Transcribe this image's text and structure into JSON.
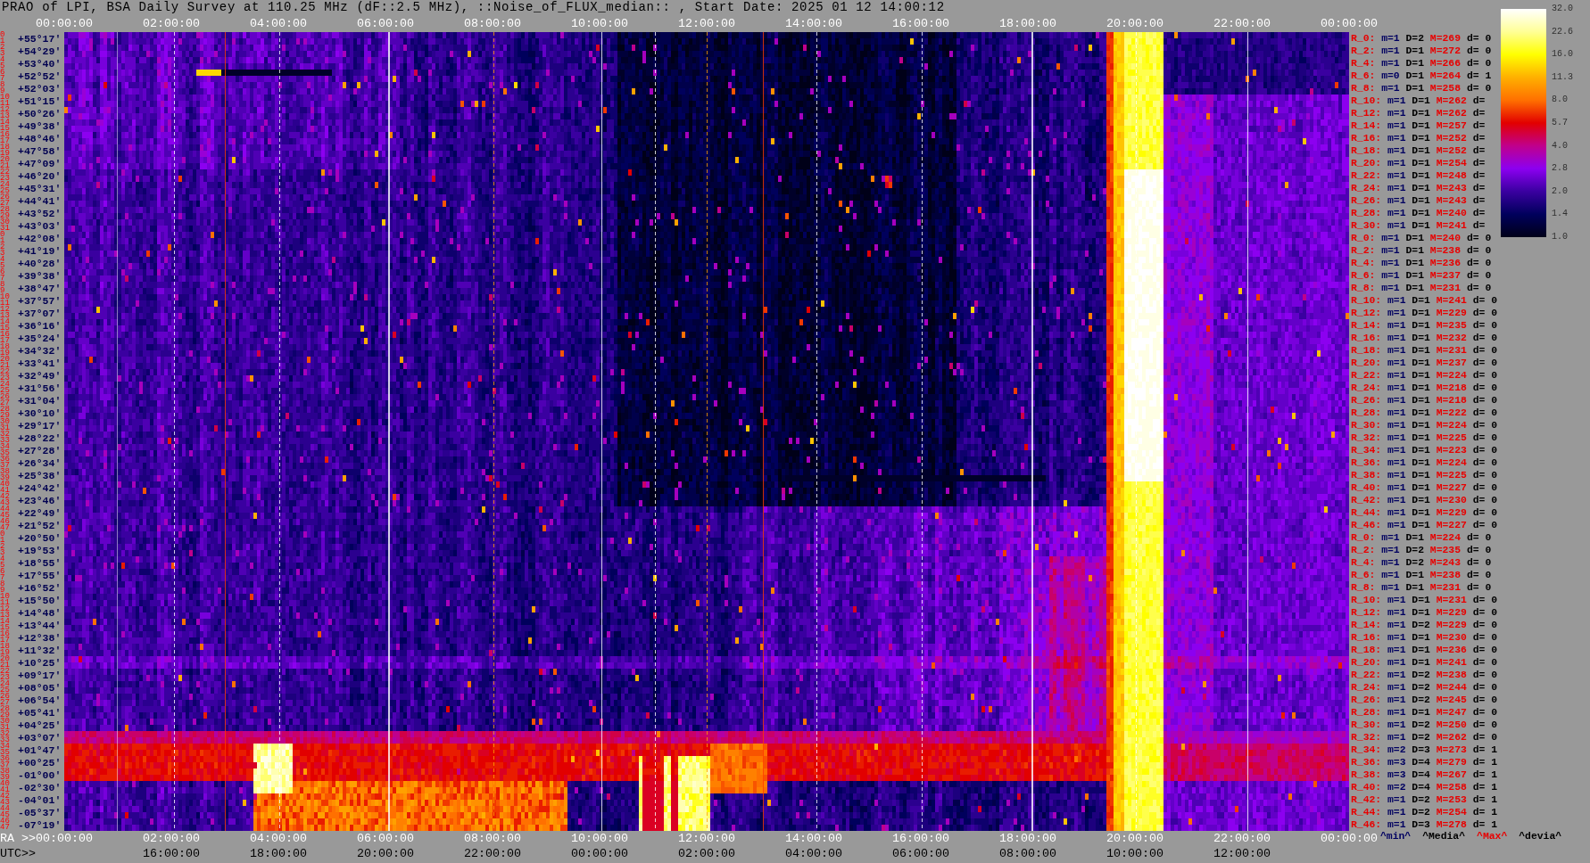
{
  "title": "PRAO of LPI, BSA Daily Survey at 110.25 MHz (dF::2.5 MHz), ::Noise_of_FLUX_median:: , Start Date: 2025 01 12 14:00:12",
  "top_axis": {
    "ticks": [
      "00:00:00",
      "02:00:00",
      "04:00:00",
      "06:00:00",
      "08:00:00",
      "10:00:00",
      "12:00:00",
      "14:00:00",
      "16:00:00",
      "18:00:00",
      "20:00:00",
      "22:00:00",
      "00:00:00"
    ]
  },
  "rows": [
    {
      "beams": [
        "0",
        "1"
      ],
      "declination": "+55°17'",
      "stats": {
        "label": "R_0:",
        "min": "m=1",
        "median": "D=2",
        "max": "M=269",
        "deviation": "d= 0"
      }
    },
    {
      "beams": [
        "2",
        "3"
      ],
      "declination": "+54°29'",
      "stats": {
        "label": "R_2:",
        "min": "m=1",
        "median": "D=1",
        "max": "M=272",
        "deviation": "d= 0"
      }
    },
    {
      "beams": [
        "4",
        "5"
      ],
      "declination": "+53°40'",
      "stats": {
        "label": "R_4:",
        "min": "m=1",
        "median": "D=1",
        "max": "M=266",
        "deviation": "d= 0"
      }
    },
    {
      "beams": [
        "6",
        "7"
      ],
      "declination": "+52°52'",
      "stats": {
        "label": "R_6:",
        "min": "m=0",
        "median": "D=1",
        "max": "M=264",
        "deviation": "d= 1"
      }
    },
    {
      "beams": [
        "8",
        "9"
      ],
      "declination": "+52°03'",
      "stats": {
        "label": "R_8:",
        "min": "m=1",
        "median": "D=1",
        "max": "M=258",
        "deviation": "d= 0"
      }
    },
    {
      "beams": [
        "10",
        "11"
      ],
      "declination": "+51°15'",
      "stats": {
        "label": "R_10:",
        "min": "m=1",
        "median": "D=1",
        "max": "M=262",
        "deviation": "d="
      }
    },
    {
      "beams": [
        "12",
        "13"
      ],
      "declination": "+50°26'",
      "stats": {
        "label": "R_12:",
        "min": "m=1",
        "median": "D=1",
        "max": "M=262",
        "deviation": "d="
      }
    },
    {
      "beams": [
        "14",
        "15"
      ],
      "declination": "+49°38'",
      "stats": {
        "label": "R_14:",
        "min": "m=1",
        "median": "D=1",
        "max": "M=257",
        "deviation": "d="
      }
    },
    {
      "beams": [
        "16",
        "17"
      ],
      "declination": "+48°46'",
      "stats": {
        "label": "R_16:",
        "min": "m=1",
        "median": "D=1",
        "max": "M=252",
        "deviation": "d="
      }
    },
    {
      "beams": [
        "18",
        "19"
      ],
      "declination": "+47°58'",
      "stats": {
        "label": "R_18:",
        "min": "m=1",
        "median": "D=1",
        "max": "M=252",
        "deviation": "d="
      }
    },
    {
      "beams": [
        "20",
        "21"
      ],
      "declination": "+47°09'",
      "stats": {
        "label": "R_20:",
        "min": "m=1",
        "median": "D=1",
        "max": "M=254",
        "deviation": "d="
      }
    },
    {
      "beams": [
        "22",
        "23"
      ],
      "declination": "+46°20'",
      "stats": {
        "label": "R_22:",
        "min": "m=1",
        "median": "D=1",
        "max": "M=248",
        "deviation": "d="
      }
    },
    {
      "beams": [
        "24",
        "25"
      ],
      "declination": "+45°31'",
      "stats": {
        "label": "R_24:",
        "min": "m=1",
        "median": "D=1",
        "max": "M=243",
        "deviation": "d="
      }
    },
    {
      "beams": [
        "26",
        "27"
      ],
      "declination": "+44°41'",
      "stats": {
        "label": "R_26:",
        "min": "m=1",
        "median": "D=1",
        "max": "M=243",
        "deviation": "d="
      }
    },
    {
      "beams": [
        "28",
        "29"
      ],
      "declination": "+43°52'",
      "stats": {
        "label": "R_28:",
        "min": "m=1",
        "median": "D=1",
        "max": "M=240",
        "deviation": "d="
      }
    },
    {
      "beams": [
        "30",
        "31"
      ],
      "declination": "+43°03'",
      "stats": {
        "label": "R_30:",
        "min": "m=1",
        "median": "D=1",
        "max": "M=241",
        "deviation": "d="
      }
    },
    {
      "beams": [
        "0",
        "1"
      ],
      "declination": "+42°08'",
      "stats": {
        "label": "R_0:",
        "min": "m=1",
        "median": "D=1",
        "max": "M=240",
        "deviation": "d= 0"
      }
    },
    {
      "beams": [
        "2",
        "3"
      ],
      "declination": "+41°19'",
      "stats": {
        "label": "R_2:",
        "min": "m=1",
        "median": "D=1",
        "max": "M=238",
        "deviation": "d= 0"
      }
    },
    {
      "beams": [
        "4",
        "5"
      ],
      "declination": "+40°28'",
      "stats": {
        "label": "R_4:",
        "min": "m=1",
        "median": "D=1",
        "max": "M=236",
        "deviation": "d= 0"
      }
    },
    {
      "beams": [
        "6",
        "7"
      ],
      "declination": "+39°38'",
      "stats": {
        "label": "R_6:",
        "min": "m=1",
        "median": "D=1",
        "max": "M=237",
        "deviation": "d= 0"
      }
    },
    {
      "beams": [
        "8",
        "9"
      ],
      "declination": "+38°47'",
      "stats": {
        "label": "R_8:",
        "min": "m=1",
        "median": "D=1",
        "max": "M=231",
        "deviation": "d= 0"
      }
    },
    {
      "beams": [
        "10",
        "11"
      ],
      "declination": "+37°57'",
      "stats": {
        "label": "R_10:",
        "min": "m=1",
        "median": "D=1",
        "max": "M=241",
        "deviation": "d= 0"
      }
    },
    {
      "beams": [
        "12",
        "13"
      ],
      "declination": "+37°07'",
      "stats": {
        "label": "R_12:",
        "min": "m=1",
        "median": "D=1",
        "max": "M=229",
        "deviation": "d= 0"
      }
    },
    {
      "beams": [
        "14",
        "15"
      ],
      "declination": "+36°16'",
      "stats": {
        "label": "R_14:",
        "min": "m=1",
        "median": "D=1",
        "max": "M=235",
        "deviation": "d= 0"
      }
    },
    {
      "beams": [
        "16",
        "17"
      ],
      "declination": "+35°24'",
      "stats": {
        "label": "R_16:",
        "min": "m=1",
        "median": "D=1",
        "max": "M=232",
        "deviation": "d= 0"
      }
    },
    {
      "beams": [
        "18",
        "19"
      ],
      "declination": "+34°32'",
      "stats": {
        "label": "R_18:",
        "min": "m=1",
        "median": "D=1",
        "max": "M=231",
        "deviation": "d= 0"
      }
    },
    {
      "beams": [
        "20",
        "21"
      ],
      "declination": "+33°41'",
      "stats": {
        "label": "R_20:",
        "min": "m=1",
        "median": "D=1",
        "max": "M=237",
        "deviation": "d= 0"
      }
    },
    {
      "beams": [
        "22",
        "23"
      ],
      "declination": "+32°49'",
      "stats": {
        "label": "R_22:",
        "min": "m=1",
        "median": "D=1",
        "max": "M=224",
        "deviation": "d= 0"
      }
    },
    {
      "beams": [
        "24",
        "25"
      ],
      "declination": "+31°56'",
      "stats": {
        "label": "R_24:",
        "min": "m=1",
        "median": "D=1",
        "max": "M=218",
        "deviation": "d= 0"
      }
    },
    {
      "beams": [
        "26",
        "27"
      ],
      "declination": "+31°04'",
      "stats": {
        "label": "R_26:",
        "min": "m=1",
        "median": "D=1",
        "max": "M=218",
        "deviation": "d= 0"
      }
    },
    {
      "beams": [
        "28",
        "29"
      ],
      "declination": "+30°10'",
      "stats": {
        "label": "R_28:",
        "min": "m=1",
        "median": "D=1",
        "max": "M=222",
        "deviation": "d= 0"
      }
    },
    {
      "beams": [
        "30",
        "31"
      ],
      "declination": "+29°17'",
      "stats": {
        "label": "R_30:",
        "min": "m=1",
        "median": "D=1",
        "max": "M=224",
        "deviation": "d= 0"
      }
    },
    {
      "beams": [
        "32",
        "33"
      ],
      "declination": "+28°22'",
      "stats": {
        "label": "R_32:",
        "min": "m=1",
        "median": "D=1",
        "max": "M=225",
        "deviation": "d= 0"
      }
    },
    {
      "beams": [
        "34",
        "35"
      ],
      "declination": "+27°28'",
      "stats": {
        "label": "R_34:",
        "min": "m=1",
        "median": "D=1",
        "max": "M=223",
        "deviation": "d= 0"
      }
    },
    {
      "beams": [
        "36",
        "37"
      ],
      "declination": "+26°34'",
      "stats": {
        "label": "R_36:",
        "min": "m=1",
        "median": "D=1",
        "max": "M=224",
        "deviation": "d= 0"
      }
    },
    {
      "beams": [
        "38",
        "39"
      ],
      "declination": "+25°38'",
      "stats": {
        "label": "R_38:",
        "min": "m=1",
        "median": "D=1",
        "max": "M=225",
        "deviation": "d= 0"
      }
    },
    {
      "beams": [
        "40",
        "41"
      ],
      "declination": "+24°42'",
      "stats": {
        "label": "R_40:",
        "min": "m=1",
        "median": "D=1",
        "max": "M=227",
        "deviation": "d= 0"
      }
    },
    {
      "beams": [
        "42",
        "43"
      ],
      "declination": "+23°46'",
      "stats": {
        "label": "R_42:",
        "min": "m=1",
        "median": "D=1",
        "max": "M=230",
        "deviation": "d= 0"
      }
    },
    {
      "beams": [
        "44",
        "45"
      ],
      "declination": "+22°49'",
      "stats": {
        "label": "R_44:",
        "min": "m=1",
        "median": "D=1",
        "max": "M=229",
        "deviation": "d= 0"
      }
    },
    {
      "beams": [
        "46",
        "47"
      ],
      "declination": "+21°52'",
      "stats": {
        "label": "R_46:",
        "min": "m=1",
        "median": "D=1",
        "max": "M=227",
        "deviation": "d= 0"
      }
    },
    {
      "beams": [
        "0",
        "1"
      ],
      "declination": "+20°50'",
      "stats": {
        "label": "R_0:",
        "min": "m=1",
        "median": "D=1",
        "max": "M=224",
        "deviation": "d= 0"
      }
    },
    {
      "beams": [
        "2",
        "3"
      ],
      "declination": "+19°53'",
      "stats": {
        "label": "R_2:",
        "min": "m=1",
        "median": "D=2",
        "max": "M=235",
        "deviation": "d= 0"
      }
    },
    {
      "beams": [
        "4",
        "5"
      ],
      "declination": "+18°55'",
      "stats": {
        "label": "R_4:",
        "min": "m=1",
        "median": "D=2",
        "max": "M=243",
        "deviation": "d= 0"
      }
    },
    {
      "beams": [
        "6",
        "7"
      ],
      "declination": "+17°55'",
      "stats": {
        "label": "R_6:",
        "min": "m=1",
        "median": "D=1",
        "max": "M=238",
        "deviation": "d= 0"
      }
    },
    {
      "beams": [
        "8",
        "9"
      ],
      "declination": "+16°52'",
      "stats": {
        "label": "R_8:",
        "min": "m=1",
        "median": "D=1",
        "max": "M=231",
        "deviation": "d= 0"
      }
    },
    {
      "beams": [
        "10",
        "11"
      ],
      "declination": "+15°50'",
      "stats": {
        "label": "R_10:",
        "min": "m=1",
        "median": "D=1",
        "max": "M=231",
        "deviation": "d= 0"
      }
    },
    {
      "beams": [
        "12",
        "13"
      ],
      "declination": "+14°48'",
      "stats": {
        "label": "R_12:",
        "min": "m=1",
        "median": "D=1",
        "max": "M=229",
        "deviation": "d= 0"
      }
    },
    {
      "beams": [
        "14",
        "15"
      ],
      "declination": "+13°44'",
      "stats": {
        "label": "R_14:",
        "min": "m=1",
        "median": "D=2",
        "max": "M=229",
        "deviation": "d= 0"
      }
    },
    {
      "beams": [
        "16",
        "17"
      ],
      "declination": "+12°38'",
      "stats": {
        "label": "R_16:",
        "min": "m=1",
        "median": "D=1",
        "max": "M=230",
        "deviation": "d= 0"
      }
    },
    {
      "beams": [
        "18",
        "19"
      ],
      "declination": "+11°32'",
      "stats": {
        "label": "R_18:",
        "min": "m=1",
        "median": "D=1",
        "max": "M=236",
        "deviation": "d= 0"
      }
    },
    {
      "beams": [
        "20",
        "21"
      ],
      "declination": "+10°25'",
      "stats": {
        "label": "R_20:",
        "min": "m=1",
        "median": "D=1",
        "max": "M=241",
        "deviation": "d= 0"
      }
    },
    {
      "beams": [
        "22",
        "23"
      ],
      "declination": "+09°17'",
      "stats": {
        "label": "R_22:",
        "min": "m=1",
        "median": "D=2",
        "max": "M=238",
        "deviation": "d= 0"
      }
    },
    {
      "beams": [
        "24",
        "25"
      ],
      "declination": "+08°05'",
      "stats": {
        "label": "R_24:",
        "min": "m=1",
        "median": "D=2",
        "max": "M=244",
        "deviation": "d= 0"
      }
    },
    {
      "beams": [
        "26",
        "27"
      ],
      "declination": "+06°54'",
      "stats": {
        "label": "R_26:",
        "min": "m=1",
        "median": "D=2",
        "max": "M=245",
        "deviation": "d= 0"
      }
    },
    {
      "beams": [
        "28",
        "29"
      ],
      "declination": "+05°41'",
      "stats": {
        "label": "R_28:",
        "min": "m=1",
        "median": "D=1",
        "max": "M=247",
        "deviation": "d= 0"
      }
    },
    {
      "beams": [
        "30",
        "31"
      ],
      "declination": "+04°25'",
      "stats": {
        "label": "R_30:",
        "min": "m=1",
        "median": "D=2",
        "max": "M=250",
        "deviation": "d= 0"
      }
    },
    {
      "beams": [
        "32",
        "33"
      ],
      "declination": "+03°07'",
      "stats": {
        "label": "R_32:",
        "min": "m=1",
        "median": "D=2",
        "max": "M=262",
        "deviation": "d= 0"
      }
    },
    {
      "beams": [
        "34",
        "35"
      ],
      "declination": "+01°47'",
      "stats": {
        "label": "R_34:",
        "min": "m=2",
        "median": "D=3",
        "max": "M=273",
        "deviation": "d= 1"
      }
    },
    {
      "beams": [
        "36",
        "37"
      ],
      "declination": "+00°25'",
      "stats": {
        "label": "R_36:",
        "min": "m=3",
        "median": "D=4",
        "max": "M=279",
        "deviation": "d= 1"
      }
    },
    {
      "beams": [
        "38",
        "39"
      ],
      "declination": "-01°00'",
      "stats": {
        "label": "R_38:",
        "min": "m=3",
        "median": "D=4",
        "max": "M=267",
        "deviation": "d= 1"
      }
    },
    {
      "beams": [
        "40",
        "41"
      ],
      "declination": "-02°30'",
      "stats": {
        "label": "R_40:",
        "min": "m=2",
        "median": "D=4",
        "max": "M=258",
        "deviation": "d= 1"
      }
    },
    {
      "beams": [
        "42",
        "43"
      ],
      "declination": "-04°01'",
      "stats": {
        "label": "R_42:",
        "min": "m=1",
        "median": "D=2",
        "max": "M=253",
        "deviation": "d= 1"
      }
    },
    {
      "beams": [
        "44",
        "45"
      ],
      "declination": "-05°37'",
      "stats": {
        "label": "R_44:",
        "min": "m=1",
        "median": "D=2",
        "max": "M=254",
        "deviation": "d= 1"
      }
    },
    {
      "beams": [
        "46",
        "47"
      ],
      "declination": "-07°19'",
      "stats": {
        "label": "R_46:",
        "min": "m=1",
        "median": "D=3",
        "max": "M=278",
        "deviation": "d= 1"
      }
    }
  ],
  "color_scale": {
    "ticks": [
      "32.0",
      "22.6",
      "16.0",
      "11.3",
      "8.0",
      "5.7",
      "4.0",
      "2.8",
      "2.0",
      "1.4",
      "1.0"
    ]
  },
  "ra_axis": {
    "label": "RA >>",
    "ticks": [
      "00:00:00",
      "02:00:00",
      "04:00:00",
      "06:00:00",
      "08:00:00",
      "10:00:00",
      "12:00:00",
      "14:00:00",
      "16:00:00",
      "18:00:00",
      "20:00:00",
      "22:00:00",
      "00:00:00"
    ]
  },
  "stats_legend": [
    {
      "kind": "min",
      "text": "^min^"
    },
    {
      "kind": "median",
      "text": "^Media^"
    },
    {
      "kind": "max",
      "text": "^Max^"
    },
    {
      "kind": "deviation",
      "text": "^devia^"
    }
  ],
  "utc_axis": {
    "label": "UTC>>",
    "ticks": [
      "16:00:00",
      "18:00:00",
      "20:00:00",
      "22:00:00",
      "00:00:00",
      "02:00:00",
      "04:00:00",
      "06:00:00",
      "08:00:00",
      "10:00:00",
      "12:00:00"
    ]
  }
}
